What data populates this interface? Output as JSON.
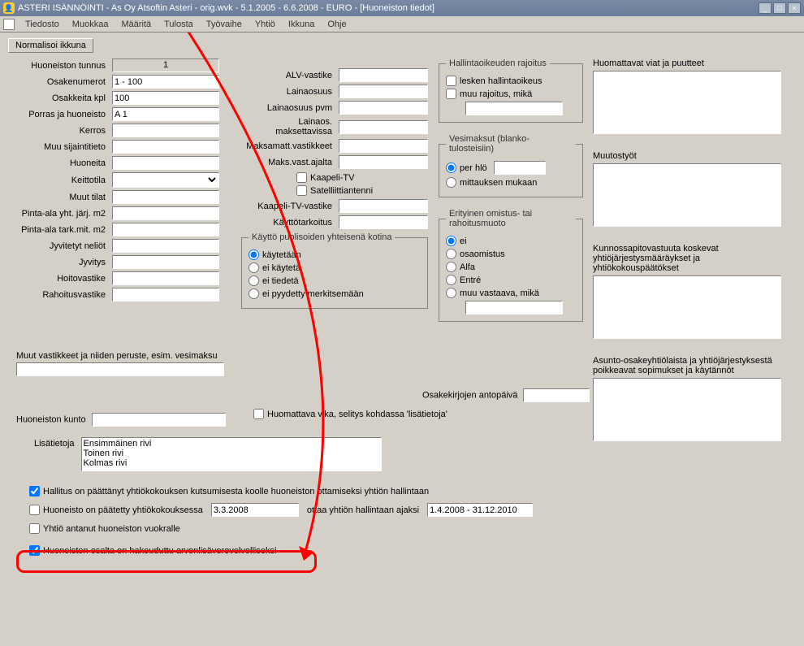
{
  "title": "ASTERI ISÄNNÖINTI - As Oy Atsoftin Asteri - orig.wvk - 5.1.2005 - 6.6.2008 - EURO - [Huoneiston tiedot]",
  "menu": {
    "file": "Tiedosto",
    "edit": "Muokkaa",
    "define": "Määritä",
    "print": "Tulosta",
    "phase": "Työvaihe",
    "company": "Yhtiö",
    "window": "Ikkuna",
    "help": "Ohje"
  },
  "normalize_btn": "Normalisoi ikkuna",
  "left": {
    "tunnus_l": "Huoneiston tunnus",
    "tunnus_v": "1",
    "osakenumerot_l": "Osakenumerot",
    "osakenumerot_v": "1 - 100",
    "osakkeita_l": "Osakkeita kpl",
    "osakkeita_v": "100",
    "porras_l": "Porras ja huoneisto",
    "porras_v": "A 1",
    "kerros_l": "Kerros",
    "kerros_v": "",
    "muusij_l": "Muu sijaintitieto",
    "muusij_v": "",
    "huoneita_l": "Huoneita",
    "huoneita_v": "",
    "keittotila_l": "Keittotila",
    "keittotila_v": "",
    "muuttilat_l": "Muut tilat",
    "muuttilat_v": "",
    "pinta_ala_yht_l": "Pinta-ala yht. järj. m2",
    "pinta_ala_yht_v": "",
    "pinta_ala_tark_l": "Pinta-ala tark.mit. m2",
    "pinta_ala_tark_v": "",
    "jyvitetyt_l": "Jyvitetyt neliöt",
    "jyvitetyt_v": "",
    "jyvitys_l": "Jyvitys",
    "jyvitys_v": "",
    "hoitov_l": "Hoitovastike",
    "hoitov_v": "",
    "rahoitusv_l": "Rahoitusvastike",
    "rahoitusv_v": ""
  },
  "mid": {
    "alv_l": "ALV-vastike",
    "alv_v": "",
    "lainaosuus_l": "Lainaosuus",
    "lainaosuus_v": "",
    "lainaosuus_pvm_l": "Lainaosuus pvm",
    "lainaosuus_pvm_v": "",
    "lainaos_maks_l": "Lainaos. maksettavissa",
    "lainaos_maks_v": "",
    "maksamatt_l": "Maksamatt.vastikkeet",
    "maksamatt_v": "",
    "maks_vast_l": "Maks.vast.ajalta",
    "maks_vast_v": "",
    "kaapelitv_chk": "Kaapeli-TV",
    "satelliitti_chk": "Satelliittiantenni",
    "kaapelitv_vastike_l": "Kaapeli-TV-vastike",
    "kaapelitv_vastike_v": "",
    "kayttotark_l": "Käyttötarkoitus",
    "kayttotark_v": "",
    "koti_legend": "Käyttö puolisoiden yhteisenä kotina",
    "koti_opt1": "käytetään",
    "koti_opt2": "ei käytetä",
    "koti_opt3": "ei tiedetä",
    "koti_opt4": "ei pyydetty merkitsemään"
  },
  "hallinta": {
    "legend": "Hallintaoikeuden rajoitus",
    "chk1": "lesken hallintaoikeus",
    "chk2": "muu rajoitus, mikä",
    "other_v": ""
  },
  "vesi": {
    "legend": "Vesimaksut (blanko-tulosteisiin)",
    "r1": "per hlö",
    "r1_v": "",
    "r2": "mittauksen mukaan"
  },
  "omistus": {
    "legend": "Erityinen omistus- tai rahoitusmuoto",
    "r1": "ei",
    "r2": "osaomistus",
    "r3": "Alfa",
    "r4": "Entré",
    "r5": "muu vastaava, mikä",
    "other_v": ""
  },
  "right": {
    "viat_l": "Huomattavat viat ja puutteet",
    "muutostyot_l": "Muutostyöt",
    "kunnossapito_l": "Kunnossapitovastuuta koskevat yhtiöjärjestysmääräykset ja yhtiökokouspäätökset",
    "poikkeavat_l": "Asunto-osakeyhtiölaista ja yhtiöjärjestyksestä poikkeavat sopimukset ja käytännöt"
  },
  "osakekirjat_l": "Osakekirjojen antopäivä",
  "osakekirjat_v": "",
  "huomattava_chk": "Huomattava vika, selitys kohdassa 'lisätietoja'",
  "muut_vast_l": "Muut vastikkeet ja niiden peruste, esim. vesimaksu",
  "muut_vast_v": "",
  "kunto_l": "Huoneiston kunto",
  "kunto_v": "",
  "lisatietoja_l": "Lisätietoja",
  "lisatietoja_v": "Ensimmäinen rivi\nToinen rivi\nKolmas rivi",
  "bottom": {
    "chk1": "Hallitus on päättänyt yhtiökokouksen kutsumisesta koolle huoneiston ottamiseksi yhtiön hallintaan",
    "chk2": "Huoneisto on päätetty yhtiökokouksessa",
    "chk2_d": "3.3.2008",
    "chk2_txt": "ottaa yhtiön hallintaan ajaksi",
    "chk2_d2": "1.4.2008 - 31.12.2010",
    "chk3": "Yhtiö antanut huoneiston vuokralle",
    "chk4": "Huoneiston osalta on hakeuduttu arvonlisäverovelvolliseksi"
  }
}
